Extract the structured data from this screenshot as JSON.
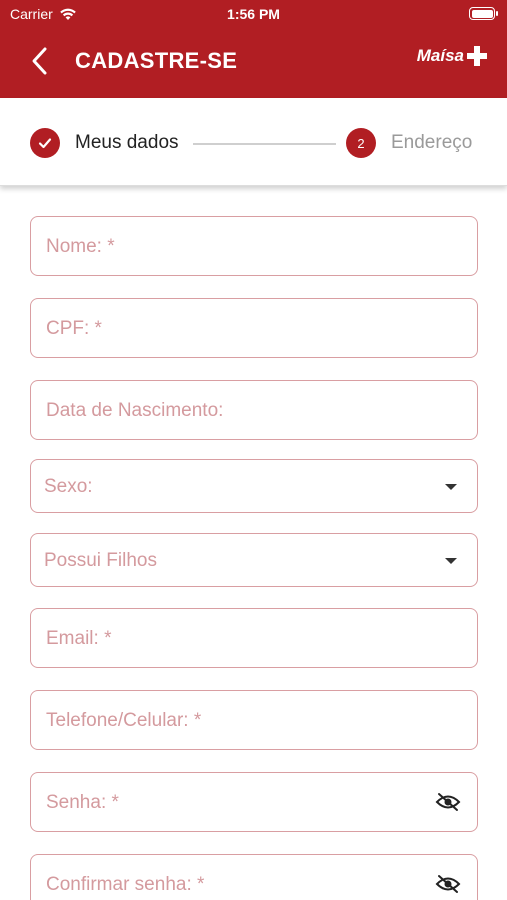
{
  "status_bar": {
    "carrier": "Carrier",
    "time": "1:56 PM"
  },
  "nav": {
    "title": "CADASTRE-SE",
    "logo": "Maísa+"
  },
  "stepper": {
    "step1_label": "Meus dados",
    "step2_number": "2",
    "step2_label": "Endereço"
  },
  "form": {
    "nome": "Nome: *",
    "cpf": "CPF: *",
    "nascimento": "Data de Nascimento:",
    "sexo": "Sexo:",
    "filhos": "Possui Filhos",
    "email": "Email: *",
    "telefone": "Telefone/Celular: *",
    "senha": "Senha: *",
    "confirmar": "Confirmar senha: *"
  },
  "colors": {
    "brand": "#b11e23",
    "field_border": "#d99ea2",
    "placeholder": "#d49a9e"
  }
}
